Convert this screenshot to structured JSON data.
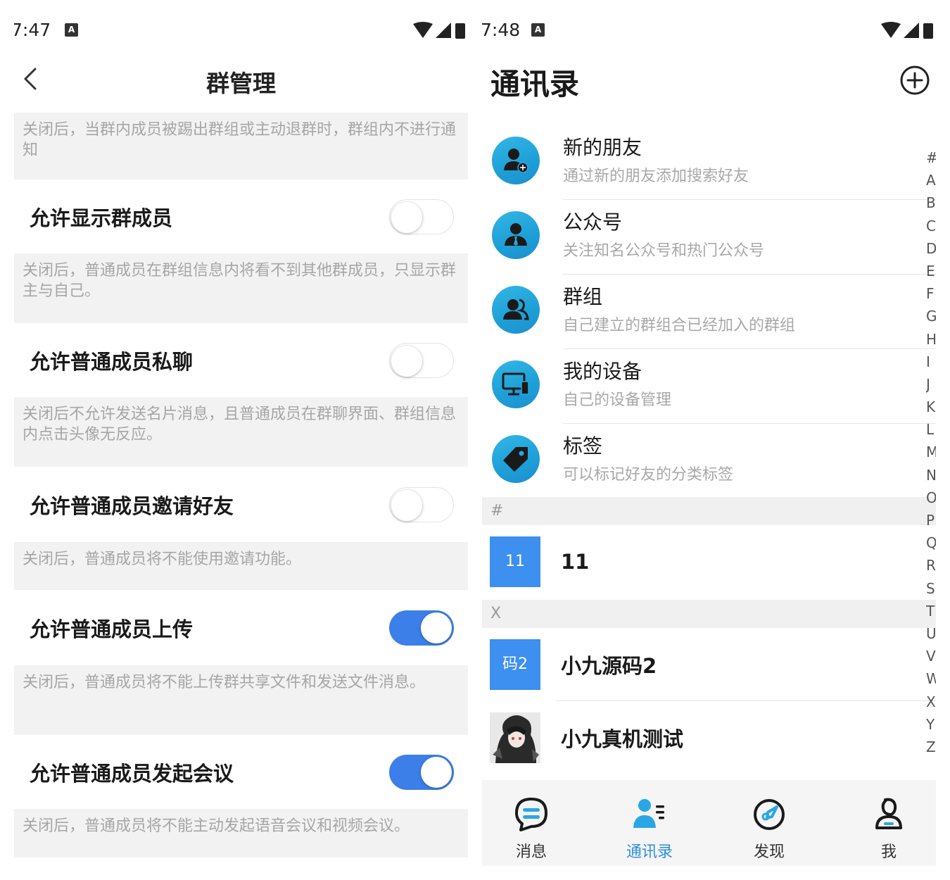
{
  "left": {
    "status": {
      "time": "7:47",
      "notif": "A"
    },
    "header": {
      "title": "群管理"
    },
    "sections": [
      {
        "desc": "关闭后，当群内成员被踢出群组或主动退群时，群组内不进行通知"
      },
      {
        "label": "允许显示群成员",
        "on": false,
        "desc": "关闭后，普通成员在群组信息内将看不到其他群成员，只显示群主与自己。"
      },
      {
        "label": "允许普通成员私聊",
        "on": false,
        "desc": "关闭后不允许发送名片消息，且普通成员在群聊界面、群组信息内点击头像无反应。"
      },
      {
        "label": "允许普通成员邀请好友",
        "on": false,
        "desc": "关闭后，普通成员将不能使用邀请功能。"
      },
      {
        "label": "允许普通成员上传",
        "on": true,
        "desc": "关闭后，普通成员将不能上传群共享文件和发送文件消息。"
      },
      {
        "label": "允许普通成员发起会议",
        "on": true,
        "desc": "关闭后，普通成员将不能主动发起语音会议和视频会议。"
      }
    ]
  },
  "right": {
    "status": {
      "time": "7:48",
      "notif": "A"
    },
    "header": {
      "title": "通讯录"
    },
    "functions": [
      {
        "title": "新的朋友",
        "subtitle": "通过新的朋友添加搜索好友",
        "icon": "add-friend-icon"
      },
      {
        "title": "公众号",
        "subtitle": "关注知名公众号和热门公众号",
        "icon": "official-account-icon"
      },
      {
        "title": "群组",
        "subtitle": "自己建立的群组合已经加入的群组",
        "icon": "group-icon"
      },
      {
        "title": "我的设备",
        "subtitle": "自己的设备管理",
        "icon": "device-icon"
      },
      {
        "title": "标签",
        "subtitle": "可以标记好友的分类标签",
        "icon": "tag-icon"
      }
    ],
    "groups": [
      {
        "letter": "#",
        "contacts": [
          {
            "name": "11",
            "avatar_text": "11"
          }
        ]
      },
      {
        "letter": "X",
        "contacts": [
          {
            "name": "小九源码2",
            "avatar_text": "码2"
          },
          {
            "name": "小九真机测试",
            "avatar_text": ""
          }
        ]
      }
    ],
    "index_letters": [
      "#",
      "A",
      "B",
      "C",
      "D",
      "E",
      "F",
      "G",
      "H",
      "I",
      "J",
      "K",
      "L",
      "M",
      "N",
      "O",
      "P",
      "Q",
      "R",
      "S",
      "T",
      "U",
      "V",
      "W",
      "X",
      "Y",
      "Z"
    ],
    "tabs": [
      {
        "label": "消息",
        "icon": "message-icon",
        "active": false
      },
      {
        "label": "通讯录",
        "icon": "contacts-icon",
        "active": true
      },
      {
        "label": "发现",
        "icon": "discover-icon",
        "active": false
      },
      {
        "label": "我",
        "icon": "me-icon",
        "active": false
      }
    ],
    "colors": {
      "accent": "#2d8fe0",
      "avatar_blue": "#3d8ff0",
      "toggle_on": "#3d7fe8"
    }
  }
}
